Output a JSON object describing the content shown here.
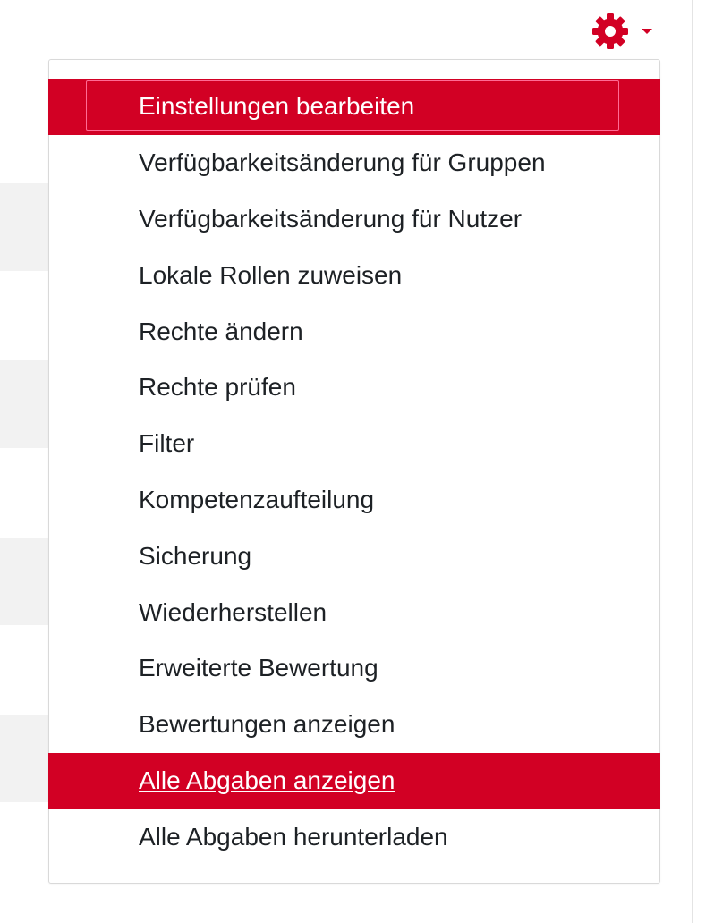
{
  "header": {
    "settings_icon": "gear-icon",
    "dropdown_caret_icon": "caret-down-icon"
  },
  "colors": {
    "accent": "#d20024",
    "text": "#1d2125",
    "border": "#d9d9d9",
    "background_block": "#f2f2f2"
  },
  "menu": {
    "items": [
      {
        "label": "Einstellungen bearbeiten",
        "state": "active-focused"
      },
      {
        "label": "Verfügbarkeitsänderung für Gruppen",
        "state": "normal"
      },
      {
        "label": "Verfügbarkeitsänderung für Nutzer",
        "state": "normal"
      },
      {
        "label": "Lokale Rollen zuweisen",
        "state": "normal"
      },
      {
        "label": "Rechte ändern",
        "state": "normal"
      },
      {
        "label": "Rechte prüfen",
        "state": "normal"
      },
      {
        "label": "Filter",
        "state": "normal"
      },
      {
        "label": "Kompetenzaufteilung",
        "state": "normal"
      },
      {
        "label": "Sicherung",
        "state": "normal"
      },
      {
        "label": "Wiederherstellen",
        "state": "normal"
      },
      {
        "label": "Erweiterte Bewertung",
        "state": "normal"
      },
      {
        "label": "Bewertungen anzeigen",
        "state": "normal"
      },
      {
        "label": "Alle Abgaben anzeigen",
        "state": "active-hovered"
      },
      {
        "label": "Alle Abgaben herunterladen",
        "state": "normal"
      }
    ]
  }
}
